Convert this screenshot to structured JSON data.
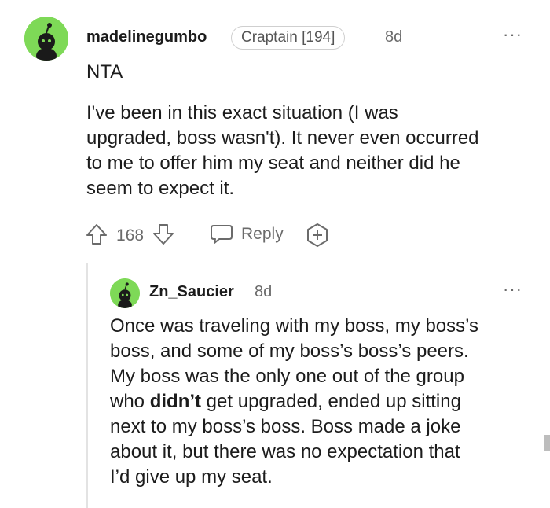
{
  "comment": {
    "username": "madelinegumbo",
    "flair": "Craptain [194]",
    "time": "8d",
    "more": "···",
    "body_title": "NTA",
    "body_lines": [
      "I've been in this exact situation (I was",
      "upgraded, boss wasn't). It never even occurred",
      "to me to offer him my seat and neither did he",
      "seem to expect it."
    ],
    "votes": "168",
    "reply_label": "Reply"
  },
  "reply": {
    "username": "Zn_Saucier",
    "time": "8d",
    "more": "···",
    "lines": [
      "Once was traveling with my boss, my boss’s",
      "boss, and some of my boss’s boss’s peers.",
      "My boss was the only one out of the group"
    ],
    "line4_pre": "who ",
    "line4_bold": "didn’t",
    "line4_post": " get upgraded, ended up sitting",
    "lines_tail": [
      "next to my boss’s boss. Boss made a joke",
      "about it, but there was no expectation that",
      "I’d give up my seat."
    ]
  },
  "colors": {
    "avatar_green": "#7ed957",
    "text": "#1c1c1c",
    "muted": "#6b6b6b"
  },
  "icons": [
    "upvote-icon",
    "downvote-icon",
    "comment-icon",
    "award-icon",
    "more-options-icon",
    "snoo-avatar-icon"
  ]
}
